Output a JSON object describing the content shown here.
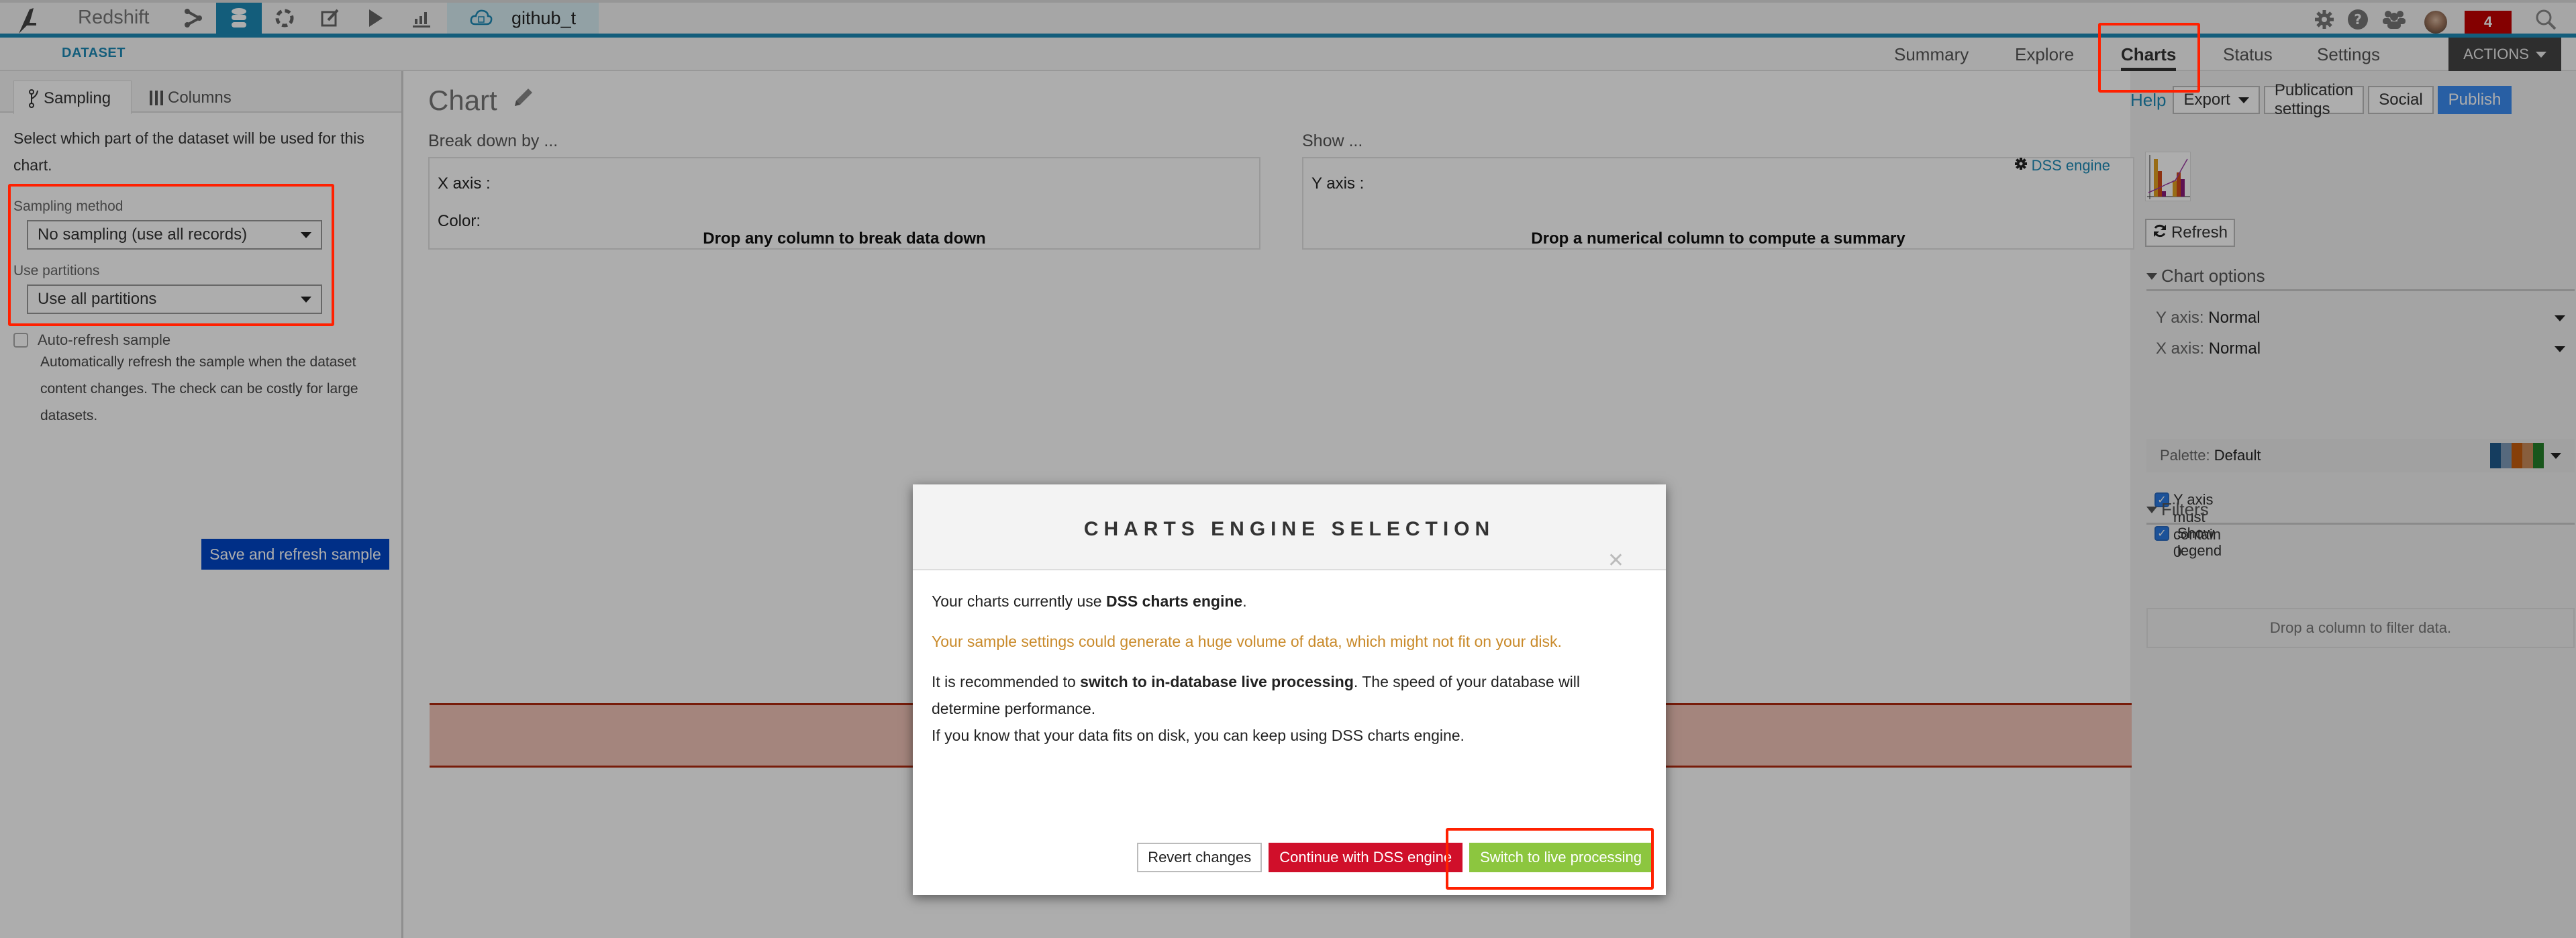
{
  "topbar": {
    "project_name": "Redshift",
    "dataset_name": "github_t",
    "notification_count": "4",
    "nav_icons": [
      "flow-icon",
      "datasets-icon",
      "recipes-icon",
      "notebooks-icon",
      "jobs-icon",
      "dashboards-icon"
    ],
    "active_nav_icon": "datasets-icon",
    "right_icons": [
      "gear-icon",
      "help-icon",
      "users-icon",
      "avatar",
      "notifications-badge",
      "search-icon"
    ]
  },
  "subnav": {
    "section": "DATASET",
    "tabs": [
      {
        "label": "Summary",
        "active": false
      },
      {
        "label": "Explore",
        "active": false
      },
      {
        "label": "Charts",
        "active": true
      },
      {
        "label": "Status",
        "active": false
      },
      {
        "label": "Settings",
        "active": false
      }
    ],
    "actions_label": "ACTIONS"
  },
  "left_panel": {
    "tabs": [
      {
        "label": "Sampling",
        "icon": "sampling-icon",
        "active": true
      },
      {
        "label": "Columns",
        "icon": "columns-icon",
        "active": false
      }
    ],
    "intro": "Select which part of the dataset will be used for this chart.",
    "sampling_method": {
      "label": "Sampling method",
      "value": "No sampling (use all records)"
    },
    "partitions": {
      "label": "Use partitions",
      "value": "Use all partitions"
    },
    "auto_refresh": {
      "label": "Auto-refresh sample",
      "checked": false,
      "help": "Automatically refresh the sample when the dataset content changes. The check can be costly for large datasets."
    },
    "save_button": "Save and refresh sample"
  },
  "main": {
    "chart_title": "Chart",
    "breakdown": {
      "label": "Break down by ...",
      "x_axis": "X axis :",
      "color": "Color:",
      "hint": "Drop any column to break data down"
    },
    "show": {
      "label": "Show ...",
      "y_axis": "Y axis :",
      "hint": "Drop a numerical column to compute a summary"
    }
  },
  "toolbar": {
    "help": "Help",
    "export": "Export",
    "publication_settings": "Publication settings",
    "social": "Social",
    "publish": "Publish"
  },
  "right_panel": {
    "engine_link": "DSS engine",
    "refresh": "Refresh",
    "chart_options": {
      "title": "Chart options",
      "y_axis": {
        "label": "Y axis:",
        "value": "Normal"
      },
      "x_axis": {
        "label": "X axis:",
        "value": "Normal"
      },
      "palette": {
        "label": "Palette:",
        "value": "Default",
        "colors": [
          "#1f5b8c",
          "#7f9bb8",
          "#c65d0e",
          "#c98b5a",
          "#257f2a"
        ]
      },
      "y_contains_zero": {
        "label": "Y axis must contain 0",
        "checked": true
      },
      "show_legend": {
        "label": "Show legend",
        "checked": true
      }
    },
    "filters": {
      "title": "Filters",
      "hint": "Drop a column to filter data."
    }
  },
  "modal": {
    "title": "CHARTS ENGINE SELECTION",
    "line1_prefix": "Your charts currently use ",
    "line1_bold": "DSS charts engine",
    "line1_suffix": ".",
    "warning": "Your sample settings could generate a huge volume of data, which might not fit on your disk.",
    "line3_prefix": "It is recommended to ",
    "line3_bold": "switch to in-database live processing",
    "line3_suffix": ". The speed of your database will determine performance.",
    "line4": "If you know that your data fits on disk, you can keep using DSS charts engine.",
    "buttons": {
      "revert": "Revert changes",
      "continue": "Continue with DSS engine",
      "switch": "Switch to live processing"
    }
  }
}
